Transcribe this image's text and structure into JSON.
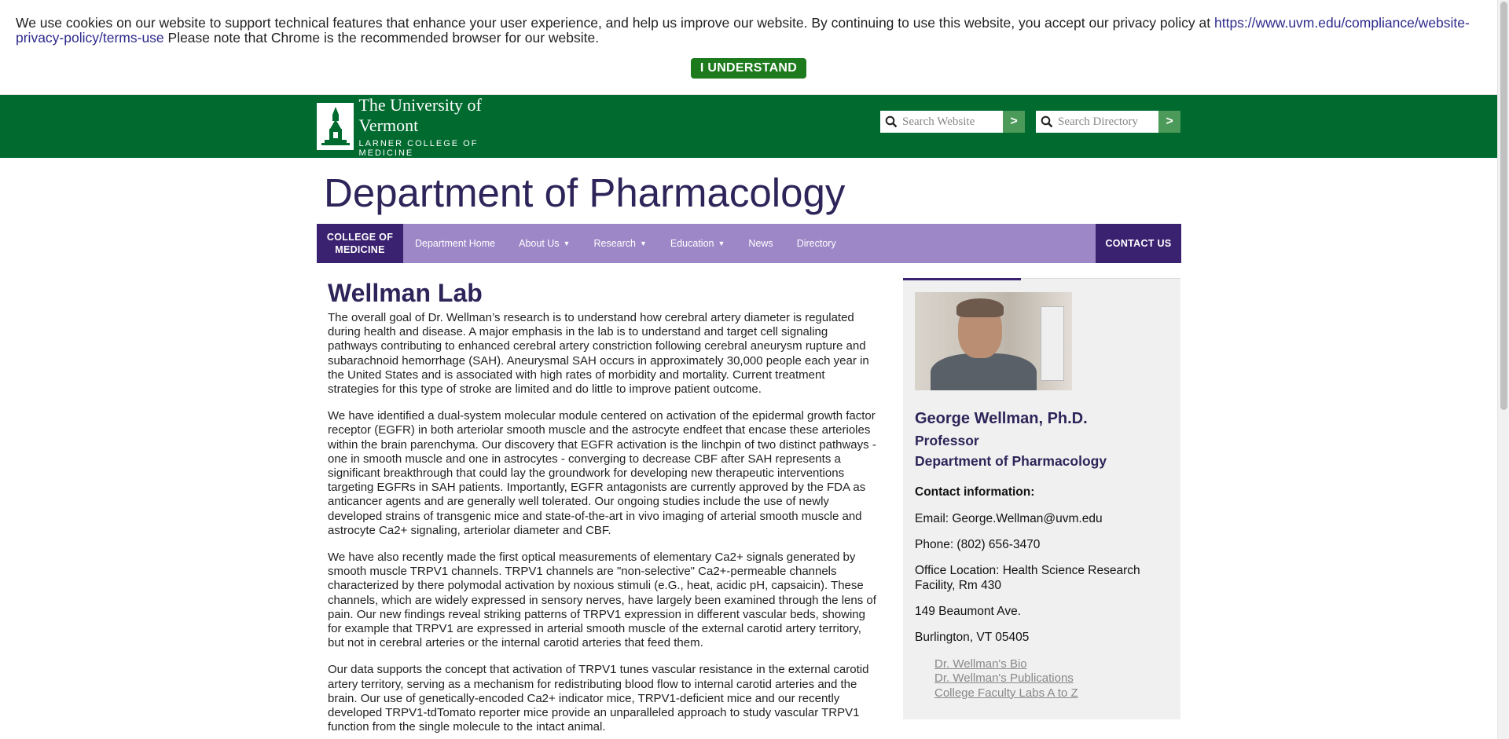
{
  "cookie_banner": {
    "message": "We use cookies on our website to support technical features that enhance your user experience, and help us improve our website. By continuing to use this website, you accept our privacy policy at ",
    "policy_link": "https://www.uvm.edu/compliance/website-privacy-policy/terms-use",
    "message_suffix": " Please note that Chrome is the recommended browser for our website.",
    "button_label": "I UNDERSTAND",
    "button_color": "#1d7a1d"
  },
  "header": {
    "logo_university": "The University of Vermont",
    "logo_college": "LARNER COLLEGE OF MEDICINE",
    "search_website_placeholder": "Search Website",
    "search_directory_placeholder": "Search Directory",
    "search_go_label": ">",
    "brand_color": "#006a2f"
  },
  "department_title": "Department of Pharmacology",
  "nav": {
    "college_label_line1": "COLLEGE OF",
    "college_label_line2": "MEDICINE",
    "items": [
      {
        "label": "Department Home",
        "dropdown": false
      },
      {
        "label": "About Us",
        "dropdown": true
      },
      {
        "label": "Research",
        "dropdown": true
      },
      {
        "label": "Education",
        "dropdown": true
      },
      {
        "label": "News",
        "dropdown": false
      },
      {
        "label": "Directory",
        "dropdown": false
      }
    ],
    "contact_label": "CONTACT US",
    "nav_color": "#9d87c7",
    "accent_color": "#3b2270"
  },
  "main": {
    "title": "Wellman Lab",
    "paragraphs": [
      "The overall goal of Dr. Wellman’s research is to understand how cerebral artery diameter is regulated during health and disease. A major emphasis in the lab is to understand and target cell signaling pathways contributing to enhanced cerebral artery constriction following cerebral aneurysm rupture and subarachnoid hemorrhage (SAH).  Aneurysmal SAH occurs in approximately 30,000 people each year in the United States and is associated with high rates of morbidity and mortality. Current treatment strategies for this type of stroke are limited and do little to improve patient outcome.",
      "We have identified a dual-system molecular module centered on activation of the epidermal growth factor receptor (EGFR) in both arteriolar smooth muscle and the astrocyte endfeet that encase these arterioles within the brain parenchyma.  Our discovery that EGFR activation is the linchpin of two distinct pathways - one in smooth muscle and one in astrocytes - converging to decrease CBF after SAH represents a significant breakthrough that could lay the groundwork for developing new therapeutic interventions targeting EGFRs in SAH patients.  Importantly, EGFR antagonists are currently approved by the FDA as anticancer agents and are generally well tolerated.  Our ongoing studies include the use of newly developed strains of transgenic mice and state-of-the-art in vivo imaging of arterial smooth muscle and astrocyte Ca2+ signaling, arteriolar diameter and CBF.",
      "We have also recently made the first optical measurements of elementary Ca2+ signals generated by smooth muscle TRPV1 channels.  TRPV1 channels are \"non-selective\" Ca2+-permeable channels characterized by there polymodal activation by noxious stimuli (e.G., heat, acidic pH, capsaicin).  These channels, which are widely expressed in sensory nerves, have largely been examined through the lens of pain.  Our new findings reveal striking patterns of TRPV1 expression in different vascular beds, showing for example that TRPV1 are expressed in arterial smooth muscle of the external carotid artery territory, but not in cerebral arteries or the internal carotid arteries that feed them.",
      "Our data supports the concept that activation of TRPV1 tunes vascular resistance in the external carotid artery territory, serving as a mechanism for redistributing blood flow to internal carotid arteries and the brain.  Our use of genetically-encoded Ca2+ indicator mice, TRPV1-deficient mice and our recently developed TRPV1-tdTomato reporter mice provide an unparalleled approach to study vascular TRPV1 function from the single molecule to the intact animal."
    ]
  },
  "sidebar": {
    "name": "George Wellman, Ph.D.",
    "role": "Professor",
    "department": "Department of Pharmacology",
    "contact_heading": "Contact information:",
    "email": "Email:  George.Wellman@uvm.edu",
    "phone": "Phone:  (802) 656-3470",
    "office": "Office Location:  Health Science Research Facility, Rm 430",
    "address1": "149 Beaumont Ave.",
    "address2": "Burlington, VT 05405",
    "links": [
      "Dr. Wellman's Bio",
      "Dr. Wellman's Publications",
      "College Faculty Labs A to Z"
    ]
  }
}
